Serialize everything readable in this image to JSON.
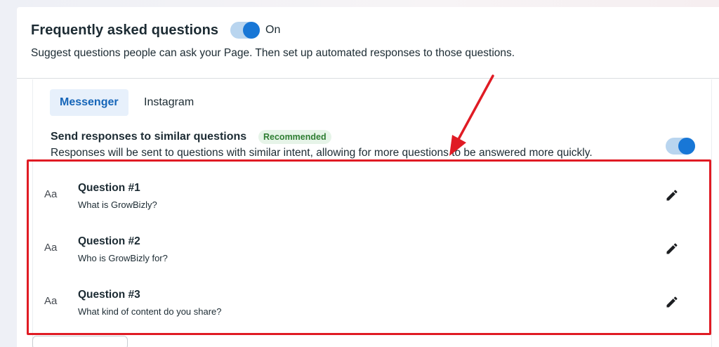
{
  "faq": {
    "title": "Frequently asked questions",
    "toggle_label": "On",
    "description": "Suggest questions people can ask your Page. Then set up automated responses to those questions."
  },
  "tabs": [
    {
      "label": "Messenger",
      "active": true
    },
    {
      "label": "Instagram",
      "active": false
    }
  ],
  "similar": {
    "title": "Send responses to similar questions",
    "badge": "Recommended",
    "description": "Responses will be sent to questions with similar intent, allowing for more questions to be answered more quickly."
  },
  "questions": [
    {
      "icon_text": "Aa",
      "title": "Question #1",
      "subtitle": "What is GrowBizly?"
    },
    {
      "icon_text": "Aa",
      "title": "Question #2",
      "subtitle": "Who is GrowBizly for?"
    },
    {
      "icon_text": "Aa",
      "title": "Question #3",
      "subtitle": "What kind of content do you share?"
    }
  ],
  "icons": {
    "edit": "pencil-icon",
    "annotation": "red-arrow-annotation"
  },
  "colors": {
    "accent": "#1877d6",
    "toggle_track": "#b9d5ef",
    "highlight": "#e01b24",
    "badge_bg": "#e6f4e8",
    "badge_text": "#2e7d32"
  }
}
